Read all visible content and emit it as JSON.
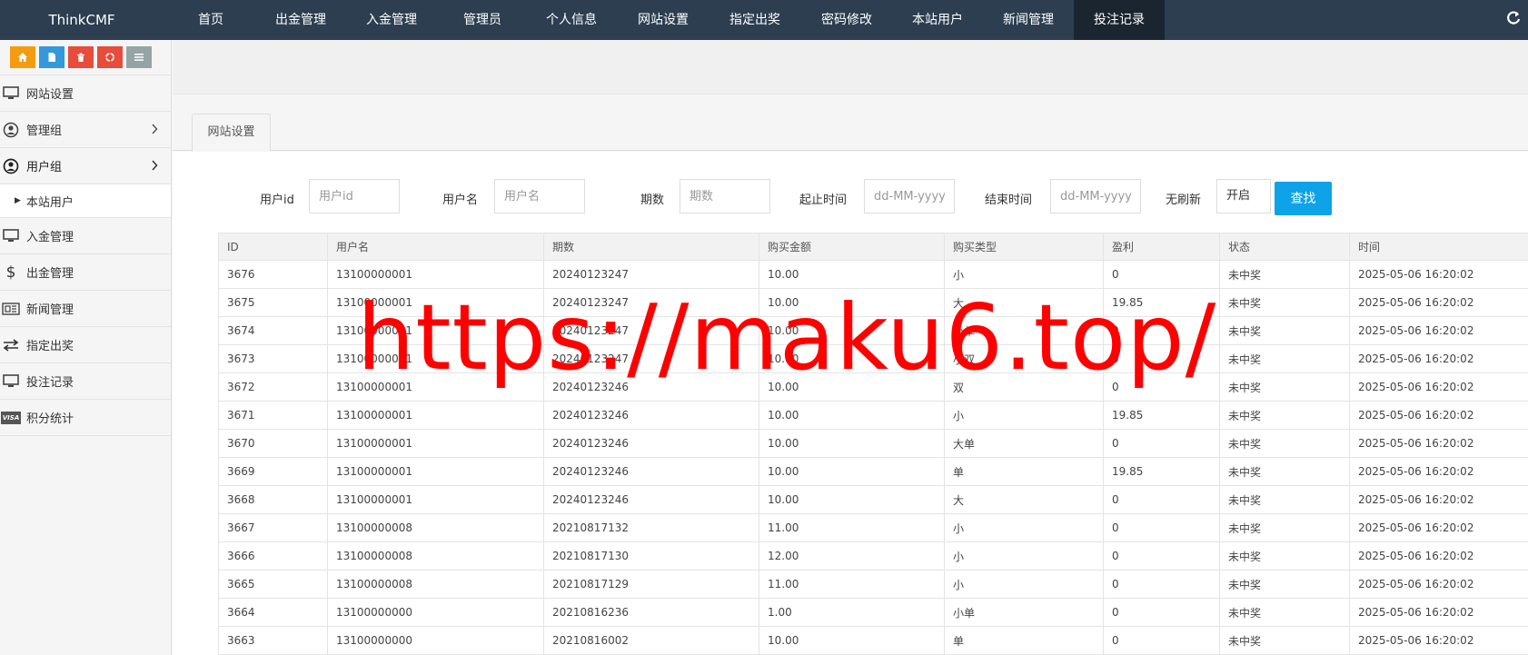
{
  "brand": "ThinkCMF",
  "nav": [
    "首页",
    "出金管理",
    "入金管理",
    "管理员",
    "个人信息",
    "网站设置",
    "指定出奖",
    "密码修改",
    "本站用户",
    "新闻管理",
    "投注记录"
  ],
  "sidebar": {
    "items": [
      {
        "label": "网站设置",
        "icon": "monitor-icon"
      },
      {
        "label": "管理组",
        "icon": "user-circle-icon"
      },
      {
        "label": "用户组",
        "icon": "user-circle-icon"
      },
      {
        "label": "本站用户"
      },
      {
        "label": "入金管理",
        "icon": "monitor-icon"
      },
      {
        "label": "出金管理",
        "icon": "dollar-icon"
      },
      {
        "label": "新闻管理",
        "icon": "newspaper-icon"
      },
      {
        "label": "指定出奖",
        "icon": "exchange-icon"
      },
      {
        "label": "投注记录",
        "icon": "monitor-icon"
      },
      {
        "label": "积分统计",
        "icon": "visa-card-icon"
      }
    ],
    "visa_text": "VISA"
  },
  "tab": "网站设置",
  "filters": {
    "user_id_label": "用户id",
    "user_id_placeholder": "用户id",
    "username_label": "用户名",
    "username_placeholder": "用户名",
    "period_label": "期数",
    "period_placeholder": "期数",
    "start_label": "起止时间",
    "start_placeholder": "dd-MM-yyyy",
    "end_label": "结束时间",
    "end_placeholder": "dd-MM-yyyy",
    "norefresh_label": "无刷新",
    "norefresh_value": "开启",
    "search_button": "查找"
  },
  "table": {
    "headers": [
      "ID",
      "用户名",
      "期数",
      "购买金额",
      "购买类型",
      "盈利",
      "状态",
      "时间"
    ],
    "rows": [
      [
        "3676",
        "13100000001",
        "20240123247",
        "10.00",
        "小",
        "0",
        "未中奖",
        "2025-05-06 16:20:02"
      ],
      [
        "3675",
        "13100000001",
        "20240123247",
        "10.00",
        "大",
        "19.85",
        "未中奖",
        "2025-05-06 16:20:02"
      ],
      [
        "3674",
        "13100000001",
        "20240123247",
        "10.00",
        "小单",
        "0",
        "未中奖",
        "2025-05-06 16:20:02"
      ],
      [
        "3673",
        "13100000001",
        "20240123247",
        "10.00",
        "小双",
        "0",
        "未中奖",
        "2025-05-06 16:20:02"
      ],
      [
        "3672",
        "13100000001",
        "20240123246",
        "10.00",
        "双",
        "0",
        "未中奖",
        "2025-05-06 16:20:02"
      ],
      [
        "3671",
        "13100000001",
        "20240123246",
        "10.00",
        "小",
        "19.85",
        "未中奖",
        "2025-05-06 16:20:02"
      ],
      [
        "3670",
        "13100000001",
        "20240123246",
        "10.00",
        "大单",
        "0",
        "未中奖",
        "2025-05-06 16:20:02"
      ],
      [
        "3669",
        "13100000001",
        "20240123246",
        "10.00",
        "单",
        "19.85",
        "未中奖",
        "2025-05-06 16:20:02"
      ],
      [
        "3668",
        "13100000001",
        "20240123246",
        "10.00",
        "大",
        "0",
        "未中奖",
        "2025-05-06 16:20:02"
      ],
      [
        "3667",
        "13100000008",
        "20210817132",
        "11.00",
        "小",
        "0",
        "未中奖",
        "2025-05-06 16:20:02"
      ],
      [
        "3666",
        "13100000008",
        "20210817130",
        "12.00",
        "小",
        "0",
        "未中奖",
        "2025-05-06 16:20:02"
      ],
      [
        "3665",
        "13100000008",
        "20210817129",
        "11.00",
        "小",
        "0",
        "未中奖",
        "2025-05-06 16:20:02"
      ],
      [
        "3664",
        "13100000000",
        "20210816236",
        "1.00",
        "小单",
        "0",
        "未中奖",
        "2025-05-06 16:20:02"
      ],
      [
        "3663",
        "13100000000",
        "20210816002",
        "10.00",
        "单",
        "0",
        "未中奖",
        "2025-05-06 16:20:02"
      ]
    ]
  },
  "watermark": "https://maku6.top/",
  "colors": {
    "topbar": "#2c3e50",
    "search_button": "#0ea2e8",
    "watermark": "#ff0000",
    "tool_home": "#f39c12",
    "tool_file": "#3498db",
    "tool_trash": "#e74c3c",
    "tool_recycle": "#e74c3c",
    "tool_list": "#95a5a6"
  }
}
